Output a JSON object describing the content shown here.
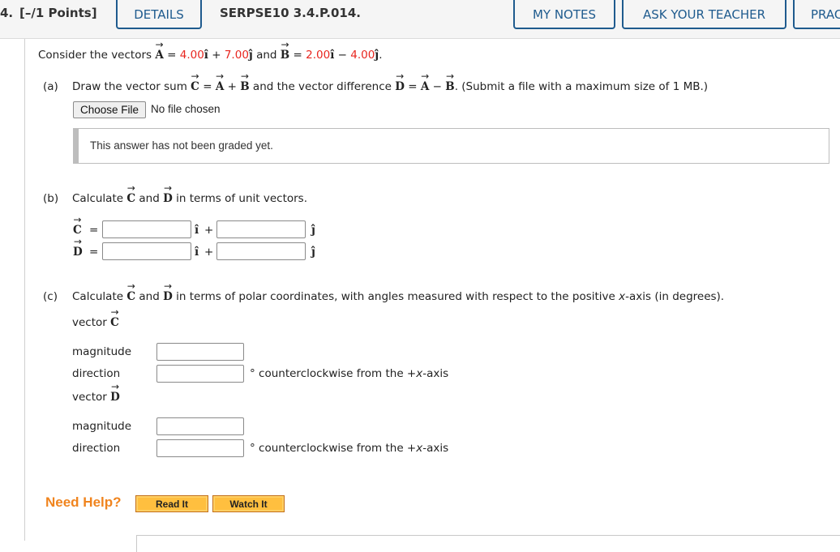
{
  "header": {
    "question_number": "4.",
    "points": "[–/1 Points]",
    "details_label": "DETAILS",
    "problem_id": "SERPSE10 3.4.P.014.",
    "my_notes_label": "MY NOTES",
    "ask_teacher_label": "ASK YOUR TEACHER",
    "practice_label": "PRAC"
  },
  "intro": {
    "prefix": "Consider the vectors",
    "vecA": "A",
    "eq": "=",
    "a_x": "4.00",
    "i_hat": "î",
    "plus": "+",
    "a_y": "7.00",
    "j_hat": "ĵ",
    "and": "and",
    "vecB": "B",
    "b_x": "2.00",
    "minus": "−",
    "b_y": "4.00",
    "period": "."
  },
  "part_a": {
    "label": "(a)",
    "text1": "Draw the vector sum",
    "vecC": "C",
    "eq": "=",
    "vecA": "A",
    "plus": "+",
    "vecB": "B",
    "text2": "and the vector difference",
    "vecD": "D",
    "minus": "−",
    "text3": ". (Submit a file with a maximum size of 1 MB.)",
    "choose_file_label": "Choose File",
    "no_file_text": "No file chosen",
    "graded_text": "This answer has not been graded yet."
  },
  "part_b": {
    "label": "(b)",
    "text1": "Calculate",
    "vecC": "C",
    "and": "and",
    "vecD": "D",
    "text2": "in terms of unit vectors.",
    "rows": [
      {
        "vec": "C",
        "eq": "=",
        "i_hat": "î",
        "plus": "+",
        "j_hat": "ĵ",
        "x_value": "",
        "y_value": ""
      },
      {
        "vec": "D",
        "eq": "=",
        "i_hat": "î",
        "plus": "+",
        "j_hat": "ĵ",
        "x_value": "",
        "y_value": ""
      }
    ]
  },
  "part_c": {
    "label": "(c)",
    "text1": "Calculate",
    "vecC": "C",
    "and": "and",
    "vecD": "D",
    "text2": "in terms of polar coordinates, with angles measured with respect to the positive",
    "x_italic": "x",
    "text3": "-axis (in degrees).",
    "vectors": [
      {
        "title": "vector",
        "vec": "C",
        "magnitude_label": "magnitude",
        "direction_label": "direction",
        "magnitude_value": "",
        "direction_value": "",
        "unit_prefix": "° counterclockwise from the +",
        "unit_x": "x",
        "unit_suffix": "-axis"
      },
      {
        "title": "vector",
        "vec": "D",
        "magnitude_label": "magnitude",
        "direction_label": "direction",
        "magnitude_value": "",
        "direction_value": "",
        "unit_prefix": "° counterclockwise from the +",
        "unit_x": "x",
        "unit_suffix": "-axis"
      }
    ]
  },
  "help": {
    "label": "Need Help?",
    "read_it": "Read It",
    "watch_it": "Watch It"
  }
}
